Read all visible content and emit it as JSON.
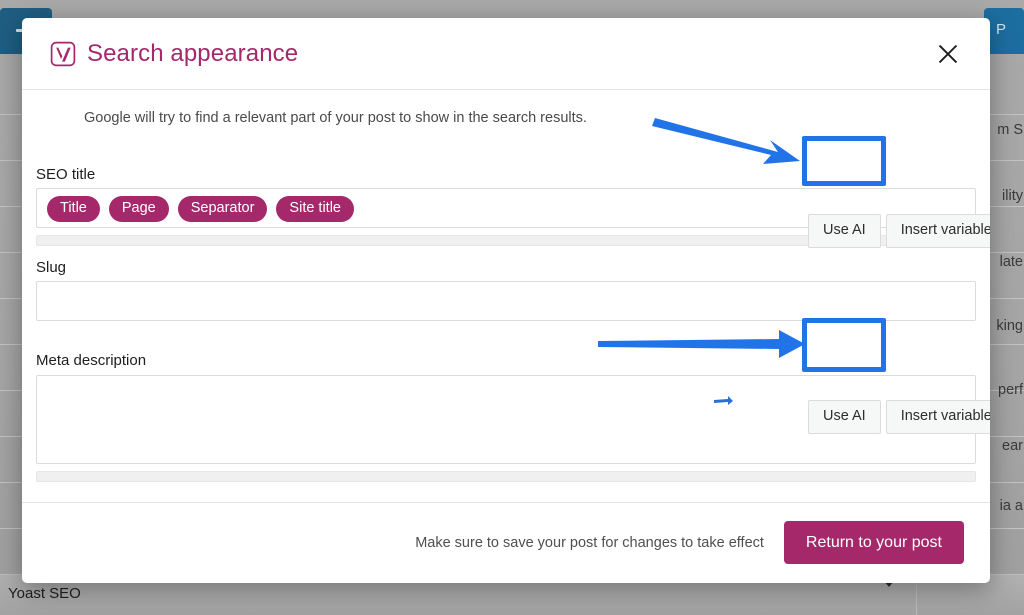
{
  "background": {
    "left_tab_icon": "collapse-tab",
    "right_tab_label": "P",
    "row_fragments": [
      "m S",
      "ility",
      "late",
      "king",
      "perf",
      "ear",
      "ia a"
    ],
    "bottom_bar_label": "Yoast SEO"
  },
  "modal": {
    "logo_icon": "yoast-logo-icon",
    "title": "Search appearance",
    "close_icon": "close-icon",
    "helper_text": "Google will try to find a relevant part of your post to show in the search results.",
    "seo_title": {
      "label": "SEO title",
      "variables": [
        "Title",
        "Page",
        "Separator",
        "Site title"
      ],
      "use_ai_label": "Use AI",
      "insert_variable_label": "Insert variable"
    },
    "slug": {
      "label": "Slug",
      "value": "",
      "placeholder": ""
    },
    "meta_description": {
      "label": "Meta description",
      "value": "",
      "placeholder": "",
      "use_ai_label": "Use AI",
      "insert_variable_label": "Insert variable"
    },
    "footer": {
      "note": "Make sure to save your post for changes to take effect",
      "return_label": "Return to your post"
    }
  },
  "annotations": {
    "accent_color": "#2174e8",
    "highlight_1_target": "use-ai-seo-title",
    "highlight_2_target": "use-ai-meta-description",
    "arrow_1": "arrow-to-use-ai-seo-title",
    "arrow_2": "arrow-to-use-ai-meta-description",
    "arrow_3": "small-arrow-artifact"
  },
  "theme": {
    "brand_pink": "#a4286a",
    "annotation_blue": "#2174e8",
    "panel_white": "#ffffff"
  }
}
